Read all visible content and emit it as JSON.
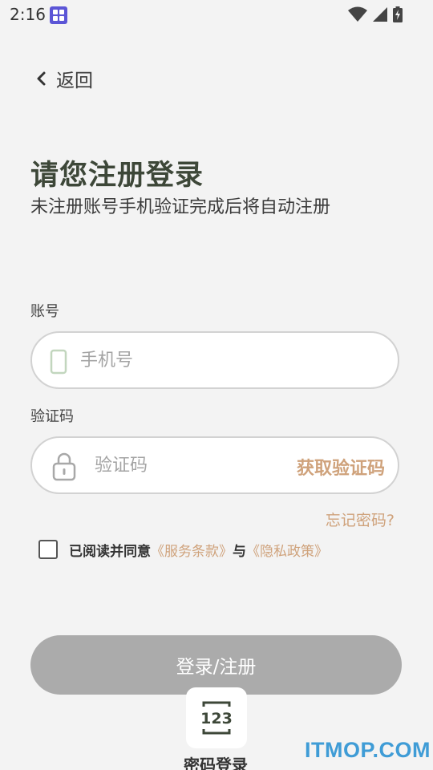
{
  "status_bar": {
    "time": "2:16",
    "icons": [
      "app-notification-icon",
      "wifi-icon",
      "signal-icon",
      "battery-charging-icon"
    ]
  },
  "nav": {
    "back_label": "返回"
  },
  "header": {
    "title": "请您注册登录",
    "subtitle": "未注册账号手机验证完成后将自动注册"
  },
  "form": {
    "account": {
      "label": "账号",
      "placeholder": "手机号",
      "value": ""
    },
    "code": {
      "label": "验证码",
      "placeholder": "验证码",
      "value": "",
      "get_code_label": "获取验证码"
    },
    "forgot_label": "忘记密码?",
    "agreement": {
      "checked": false,
      "prefix": "已阅读并同意",
      "terms_link": "《服务条款》",
      "connector": "与",
      "privacy_link": "《隐私政策》"
    },
    "submit_label": "登录/注册"
  },
  "alt_login": {
    "label": "密码登录",
    "icon_text": "123"
  },
  "watermark": "ITMOP.COM",
  "colors": {
    "accent": "#cfa27b",
    "title": "#3d4738",
    "button_disabled": "#ababab",
    "background": "#f3f3f3"
  }
}
